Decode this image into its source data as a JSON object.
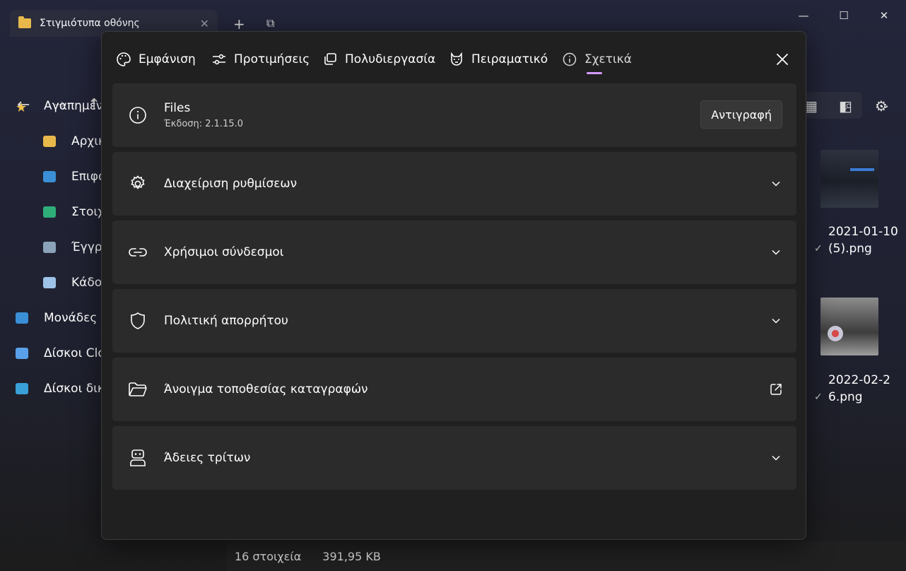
{
  "window": {
    "tab_title": "Στιγμιότυπα οθόνης",
    "tab_close": "✕",
    "new_tab": "+",
    "dup_tab": "⧉",
    "minimize": "—",
    "maximize": "☐",
    "close": "✕"
  },
  "navbar": {
    "back": "←",
    "forward": "→",
    "up": "↑",
    "search_icon": "⌕",
    "settings_icon": "⚙"
  },
  "sidebar": {
    "items": [
      {
        "label": "Αγαπημένα",
        "icon": "star-icon",
        "color": "#f2c14e"
      },
      {
        "label": "Αρχική",
        "icon": "home-icon",
        "color": "#e8b84a"
      },
      {
        "label": "Επιφάνεια εργασίας",
        "icon": "desktop-folder-icon",
        "color": "#3a8fd6"
      },
      {
        "label": "Στοιχεία λήψης",
        "icon": "downloads-folder-icon",
        "color": "#2fae7a"
      },
      {
        "label": "Έγγραφα",
        "icon": "documents-folder-icon",
        "color": "#8aa3b8"
      },
      {
        "label": "Κάδος ανακύκλωσης",
        "icon": "recycle-bin-icon",
        "color": "#9fc3e8"
      },
      {
        "label": "Μονάδες δίσκου",
        "icon": "drives-icon",
        "color": "#3a8fd6"
      },
      {
        "label": "Δίσκοι Cloud",
        "icon": "cloud-drive-icon",
        "color": "#5aa0e8"
      },
      {
        "label": "Δίσκοι δικτύου",
        "icon": "network-drive-icon",
        "color": "#3aa0d8"
      }
    ]
  },
  "files": [
    {
      "name_line1": "2021-01-10",
      "name_line2": "(5).png"
    },
    {
      "name_line1": "2022-02-2",
      "name_line2": "6.png"
    }
  ],
  "statusbar": {
    "count": "16 στοιχεία",
    "size": "391,95 KB"
  },
  "dialog": {
    "tabs": [
      {
        "label": "Εμφάνιση",
        "icon": "palette-icon"
      },
      {
        "label": "Προτιμήσεις",
        "icon": "sliders-icon"
      },
      {
        "label": "Πολυδιεργασία",
        "icon": "multitask-icon"
      },
      {
        "label": "Πειραματικό",
        "icon": "experimental-icon"
      },
      {
        "label": "Σχετικά",
        "icon": "info-icon"
      }
    ],
    "active_tab": "Σχετικά",
    "accent": "#d49bff",
    "about": {
      "title": "Files",
      "version": "Έκδοση: 2.1.15.0",
      "copy_label": "Αντιγραφή"
    },
    "sections": [
      {
        "title": "Διαχείριση ρυθμίσεων",
        "icon": "gear-icon"
      },
      {
        "title": "Χρήσιμοι σύνδεσμοι",
        "icon": "link-icon"
      },
      {
        "title": "Πολιτική απορρήτου",
        "icon": "shield-icon"
      },
      {
        "title": "Άνοιγμα τοποθεσίας καταγραφών",
        "icon": "folder-open-icon"
      },
      {
        "title": "Άδειες τρίτων",
        "icon": "robot-icon"
      }
    ]
  }
}
